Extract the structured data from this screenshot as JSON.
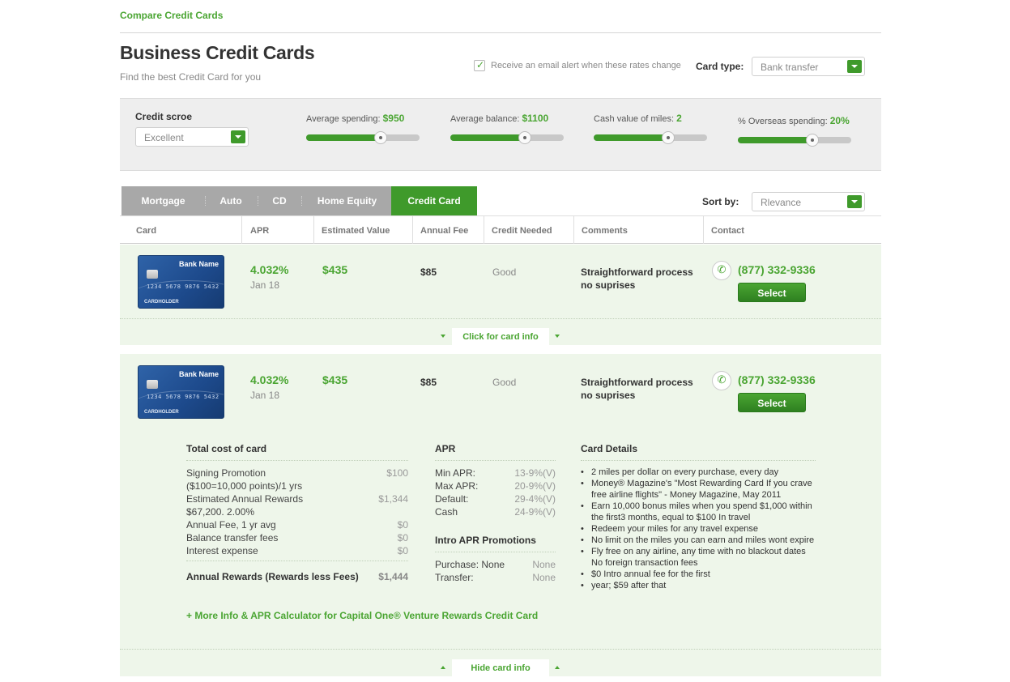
{
  "header": {
    "top_link": "Compare Credit Cards",
    "title": "Business Credit Cards",
    "subtitle": "Find the best Credit Card for you",
    "email_alert_label": "Receive an email alert when these rates change",
    "card_type_label": "Card type:",
    "card_type_value": "Bank transfer"
  },
  "filters": {
    "credit_score_label": "Credit scroe",
    "credit_score_value": "Excellent",
    "sliders": [
      {
        "label": "Average spending:",
        "value": "$950",
        "level": 0.66
      },
      {
        "label": "Average balance:",
        "value": "$1100",
        "level": 0.66
      },
      {
        "label": "Cash value of miles:",
        "value": "2",
        "level": 0.66
      },
      {
        "label": "% Overseas spending:",
        "value": "20%",
        "level": 0.66
      }
    ]
  },
  "tabs": [
    "Mortgage",
    "Auto",
    "CD",
    "Home Equity",
    "Credit Card"
  ],
  "active_tab": "Credit Card",
  "sort": {
    "label": "Sort by:",
    "value": "Rlevance"
  },
  "columns": [
    "Card",
    "APR",
    "Estimated Value",
    "Annual Fee",
    "Credit Needed",
    "Comments",
    "Contact"
  ],
  "card_graphic": {
    "bank": "Bank Name",
    "number": "1234 5678 9876 5432",
    "sub": "1234",
    "holder": "CARDHOLDER"
  },
  "rows": [
    {
      "apr": "4.032%",
      "date": "Jan 18",
      "estimated_value": "$435",
      "annual_fee": "$85",
      "credit_needed": "Good",
      "comment_1": "Straightforward process",
      "comment_2": "no suprises",
      "phone": "(877) 332-9336",
      "select_label": "Select",
      "toggle_label": "Click for card info"
    },
    {
      "apr": "4.032%",
      "date": "Jan 18",
      "estimated_value": "$435",
      "annual_fee": "$85",
      "credit_needed": "Good",
      "comment_1": "Straightforward process",
      "comment_2": "no suprises",
      "phone": "(877) 332-9336",
      "select_label": "Select",
      "toggle_label": "Hide card info"
    }
  ],
  "details": {
    "cost_title": "Total cost of card",
    "cost_items": [
      {
        "label": "Signing Promotion",
        "value": "$100"
      },
      {
        "label": "($100=10,000 points)/1 yrs",
        "value": ""
      },
      {
        "label": "Estimated Annual Rewards",
        "value": "$1,344"
      },
      {
        "label": "$67,200. 2.00%",
        "value": ""
      },
      {
        "label": "Annual Fee, 1 yr avg",
        "value": "$0"
      },
      {
        "label": "Balance transfer fees",
        "value": "$0"
      },
      {
        "label": "Interest expense",
        "value": "$0"
      }
    ],
    "cost_total_label": "Annual Rewards (Rewards less Fees)",
    "cost_total_value": "$1,444",
    "apr_title": "APR",
    "apr_items": [
      {
        "label": "Min APR:",
        "value": "13-9%(V)"
      },
      {
        "label": "Max APR:",
        "value": "20-9%(V)"
      },
      {
        "label": "Default:",
        "value": "29-4%(V)"
      },
      {
        "label": "Cash",
        "value": "24-9%(V)"
      }
    ],
    "intro_title": "Intro APR Promotions",
    "intro_items": [
      {
        "label": "Purchase: None",
        "value": "None"
      },
      {
        "label": "Transfer:",
        "value": "None"
      }
    ],
    "card_details_title": "Card Details",
    "card_details": [
      "2 miles per dollar on every purchase, every day",
      "Money® Magazine's \"Most Rewarding Card If you crave",
      "free airline flights\" - Money Magazine, May 2011",
      "Earn 10,000 bonus miles when you spend $1,000 within",
      "the first3 months, equal to $100 In travel",
      "Redeem your miles for any travel expense",
      "No limit on the miles you can earn and miles wont expire",
      "Fly free on any airline, any time with no blackout dates",
      "No foreign transaction fees",
      "$0 Intro annual fee for the first",
      "year; $59 after that"
    ],
    "more_link": "+ More Info & APR Calculator for Capital One® Venture Rewards Credit Card"
  },
  "colors": {
    "accent": "#4aa532",
    "accent_dark": "#3f9a2b",
    "row_bg": "#eef6ea",
    "band_bg": "#eeeeee"
  },
  "icons": [
    "checkmark-icon",
    "dropdown-arrow-icon",
    "phone-icon",
    "caret-down-icon",
    "caret-up-icon",
    "credit-card-image"
  ]
}
